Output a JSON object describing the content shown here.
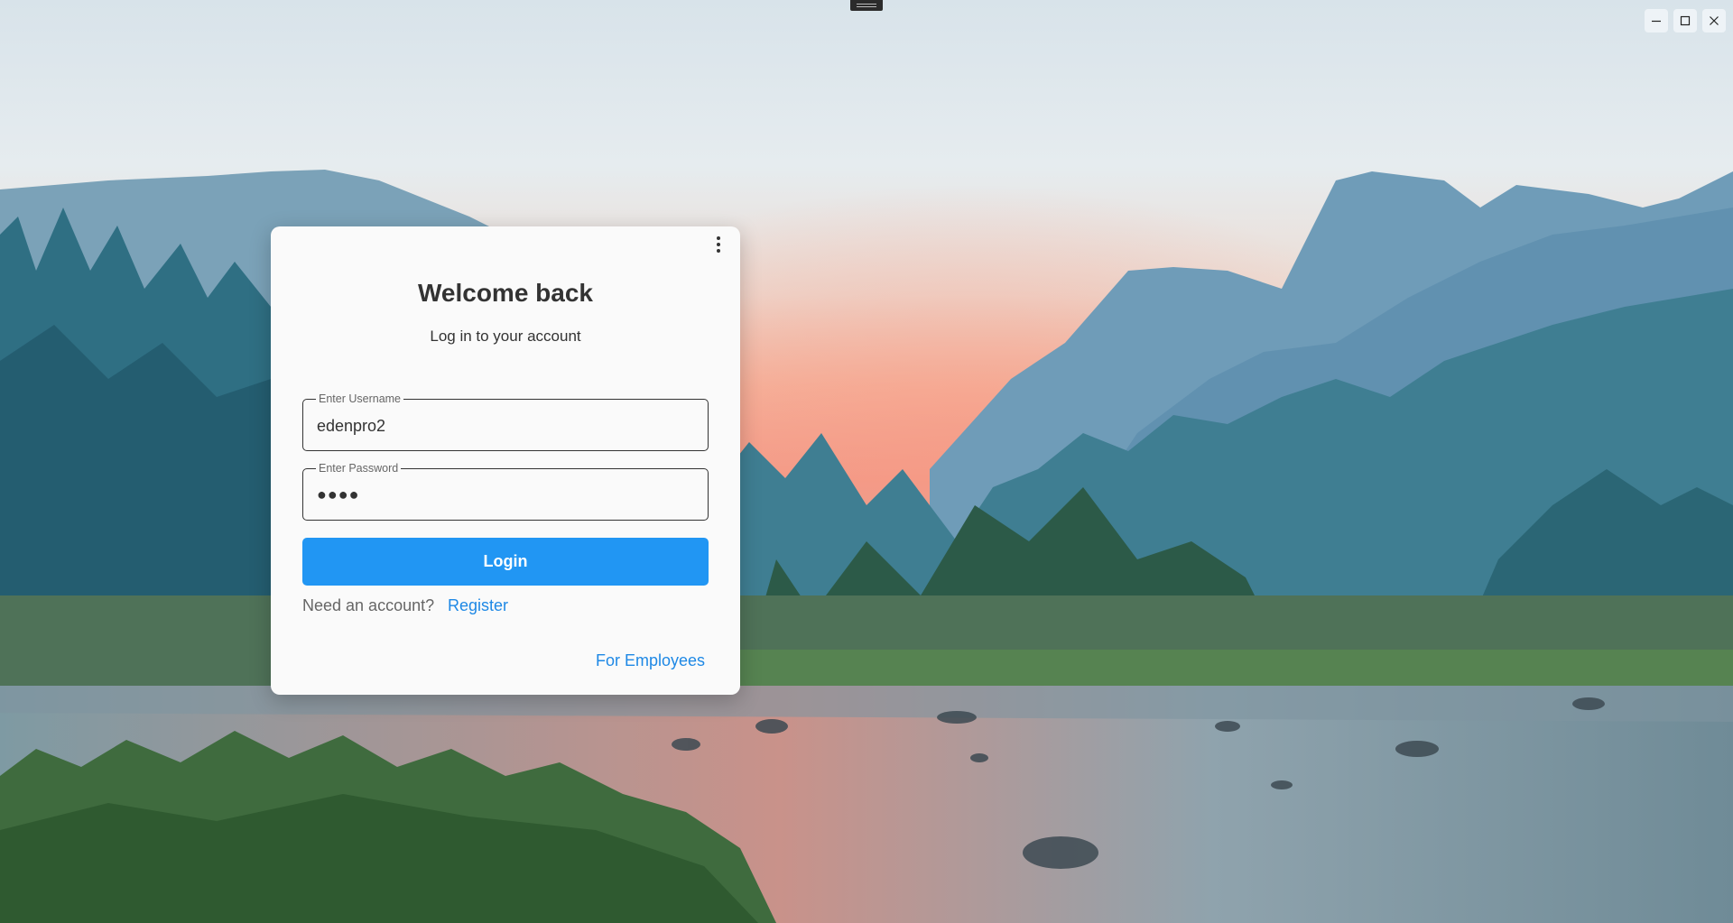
{
  "window": {
    "minimize_icon": "minimize-icon",
    "maximize_icon": "maximize-icon",
    "close_icon": "close-icon"
  },
  "login": {
    "title": "Welcome back",
    "subtitle": "Log in to your account",
    "username": {
      "label": "Enter Username",
      "value": "edenpro2"
    },
    "password": {
      "label": "Enter Password",
      "value": "●●●●"
    },
    "login_label": "Login",
    "need_account": "Need an account?",
    "register_label": "Register",
    "employees_label": "For Employees"
  },
  "colors": {
    "accent": "#2196f3",
    "link": "#1e88e5",
    "card_background": "#fafafa"
  }
}
